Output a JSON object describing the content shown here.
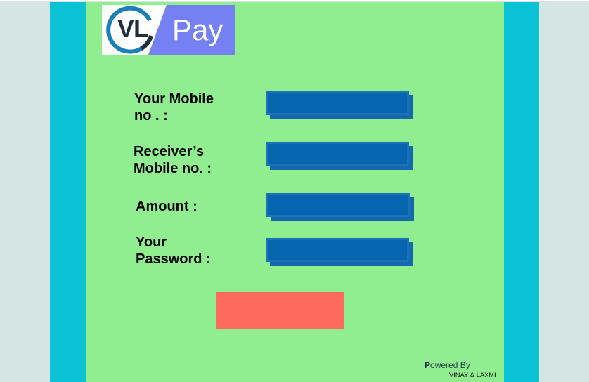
{
  "logo": {
    "vl_text": "VL",
    "pay_text": "Pay",
    "ring_color": "#1b7fba",
    "pay_color": "#7581f2"
  },
  "form": {
    "fields": [
      {
        "label": "Your Mobile\nno . :",
        "value": "",
        "placeholder": ""
      },
      {
        "label": "Receiver’s\nMobile no. :",
        "value": "",
        "placeholder": ""
      },
      {
        "label": "Amount   :",
        "value": "",
        "placeholder": ""
      },
      {
        "label": "Your\nPassword :",
        "value": "",
        "placeholder": ""
      }
    ],
    "submit_label": ""
  },
  "footer": {
    "powered_first": "P",
    "powered_rest": "owered By",
    "authors": "VINAY & LAXMI"
  },
  "colors": {
    "panel": "#90ee90",
    "frame": "#0bc2d5",
    "input": "#0764ae",
    "button": "#ff6a5e"
  }
}
